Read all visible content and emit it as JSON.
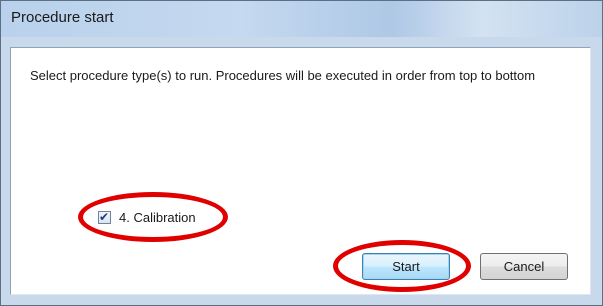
{
  "window": {
    "title": "Procedure start"
  },
  "dialog": {
    "description": "Select procedure type(s) to run. Procedures will be executed in order from top to bottom",
    "procedures": [
      {
        "label": "4. Calibration",
        "checked": true
      }
    ],
    "buttons": {
      "start_label": "Start",
      "cancel_label": "Cancel"
    }
  },
  "colors": {
    "annotation": "#e00000",
    "titlebar": "#c5d9ef",
    "start_button_border": "#3c7fb1"
  }
}
